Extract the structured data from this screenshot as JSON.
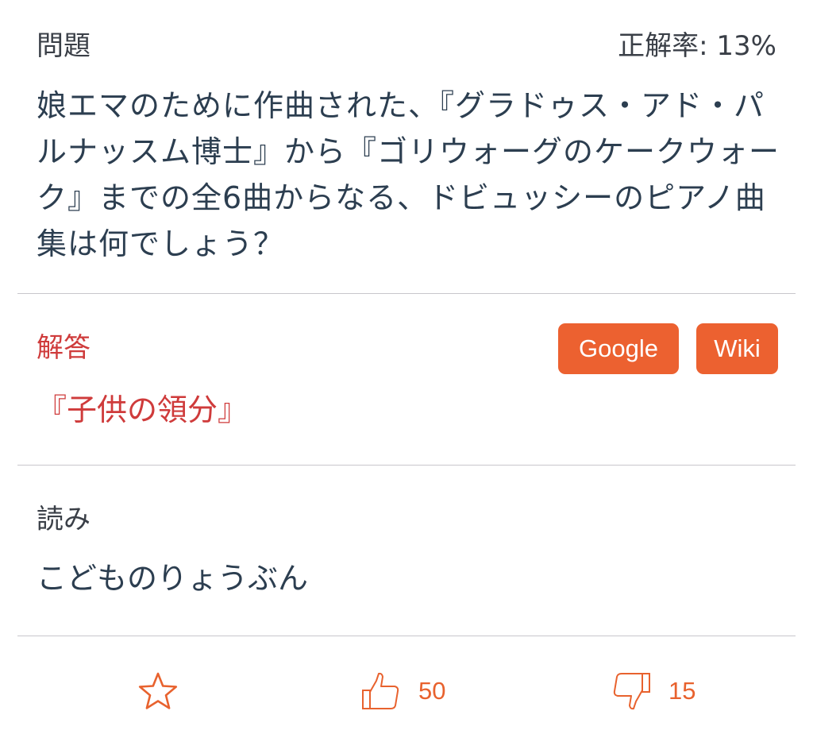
{
  "question": {
    "label": "問題",
    "rate": "正解率: 13%",
    "text": "娘エマのために作曲された、『グラドゥス・アド・パルナッスム博士』から『ゴリウォーグのケークウォーク』までの全6曲からなる、ドビュッシーのピアノ曲集は何でしょう？"
  },
  "answer": {
    "label": "解答",
    "text": "『子供の領分』",
    "google_label": "Google",
    "wiki_label": "Wiki"
  },
  "reading": {
    "label": "読み",
    "text": "こどものりょうぶん"
  },
  "actions": {
    "favorite_icon": "star-outline-icon",
    "like_icon": "thumbs-up-icon",
    "like_count": "50",
    "dislike_icon": "thumbs-down-icon",
    "dislike_count": "15"
  },
  "colors": {
    "accent": "#ec6130",
    "answer": "#cf3b3b",
    "text": "#2c3e50",
    "divider": "#c8c7cc"
  }
}
